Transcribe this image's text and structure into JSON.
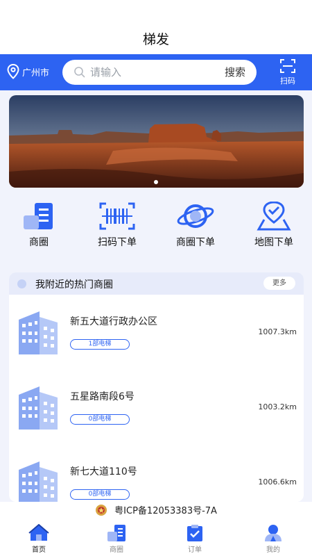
{
  "header": {
    "title": "梯发"
  },
  "search": {
    "city": "广州市",
    "placeholder": "请输入",
    "button": "搜索",
    "scan_label": "扫码"
  },
  "quick_actions": [
    {
      "label": "商圈",
      "icon": "building-stack-icon"
    },
    {
      "label": "扫码下单",
      "icon": "barcode-scan-icon"
    },
    {
      "label": "商圈下单",
      "icon": "planet-icon"
    },
    {
      "label": "地图下单",
      "icon": "map-pin-check-icon"
    }
  ],
  "hot_areas": {
    "title": "我附近的热门商圈",
    "more": "更多",
    "items": [
      {
        "name": "新五大道行政办公区",
        "elevators": "1部电梯",
        "distance": "1007.3km"
      },
      {
        "name": "五星路南段6号",
        "elevators": "0部电梯",
        "distance": "1003.2km"
      },
      {
        "name": "新七大道110号",
        "elevators": "0部电梯",
        "distance": "1006.6km"
      }
    ]
  },
  "footer": {
    "icp": "粤ICP备12053383号-7A"
  },
  "tabs": [
    {
      "label": "首页",
      "icon": "home-icon",
      "active": true
    },
    {
      "label": "商圈",
      "icon": "building-icon",
      "active": false
    },
    {
      "label": "订单",
      "icon": "clipboard-check-icon",
      "active": false
    },
    {
      "label": "我的",
      "icon": "user-icon",
      "active": false
    }
  ],
  "colors": {
    "primary": "#2d63f2",
    "background": "#f1f3fc"
  }
}
